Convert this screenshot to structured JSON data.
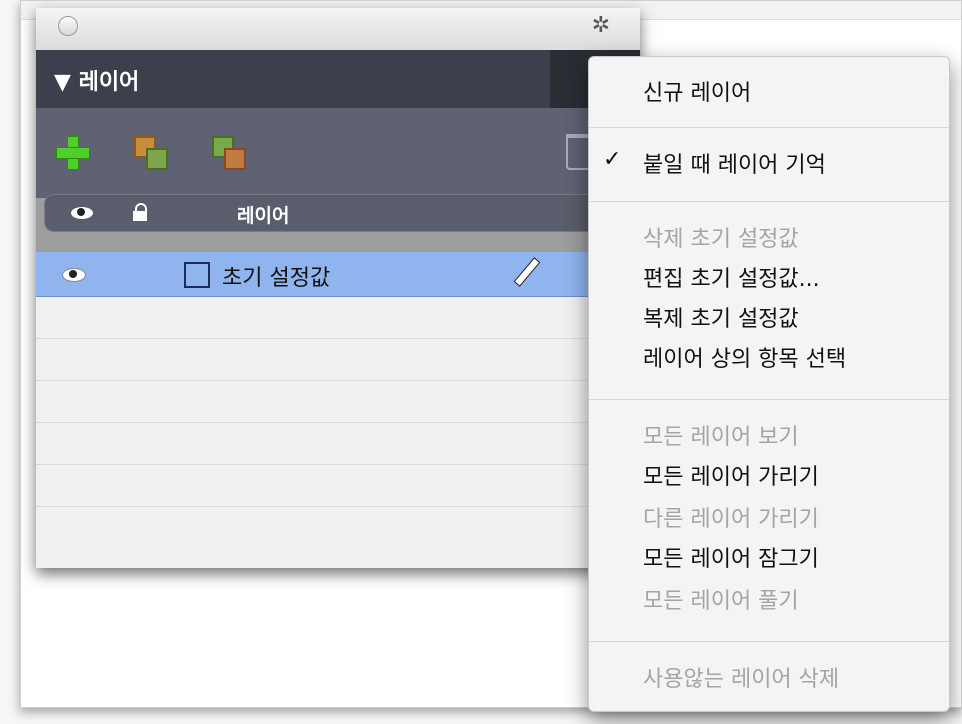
{
  "panel": {
    "gear_glyph": "✲",
    "header_title": "▼ 레이어",
    "column_header": "레이어",
    "layers": [
      {
        "name": "초기 설정값",
        "selected": true
      }
    ]
  },
  "menu": {
    "items": [
      {
        "label": "신규 레이어",
        "enabled": true,
        "checked": false
      },
      {
        "label": "붙일 때 레이어 기억",
        "enabled": true,
        "checked": true
      },
      {
        "label": "삭제 초기 설정값",
        "enabled": false,
        "checked": false
      },
      {
        "label": "편집 초기 설정값...",
        "enabled": true,
        "checked": false
      },
      {
        "label": "복제 초기 설정값",
        "enabled": true,
        "checked": false
      },
      {
        "label": "레이어 상의 항목 선택",
        "enabled": true,
        "checked": false
      },
      {
        "label": "모든 레이어 보기",
        "enabled": false,
        "checked": false
      },
      {
        "label": "모든 레이어 가리기",
        "enabled": true,
        "checked": false
      },
      {
        "label": "다른 레이어 가리기",
        "enabled": false,
        "checked": false
      },
      {
        "label": "모든 레이어 잠그기",
        "enabled": true,
        "checked": false
      },
      {
        "label": "모든 레이어 풀기",
        "enabled": false,
        "checked": false
      },
      {
        "label": "사용않는 레이어 삭제",
        "enabled": false,
        "checked": false
      }
    ]
  },
  "colors": {
    "selected_row": "#8fb4ee",
    "panel_header": "#3d404c",
    "add_icon": "#4fcf2c"
  }
}
